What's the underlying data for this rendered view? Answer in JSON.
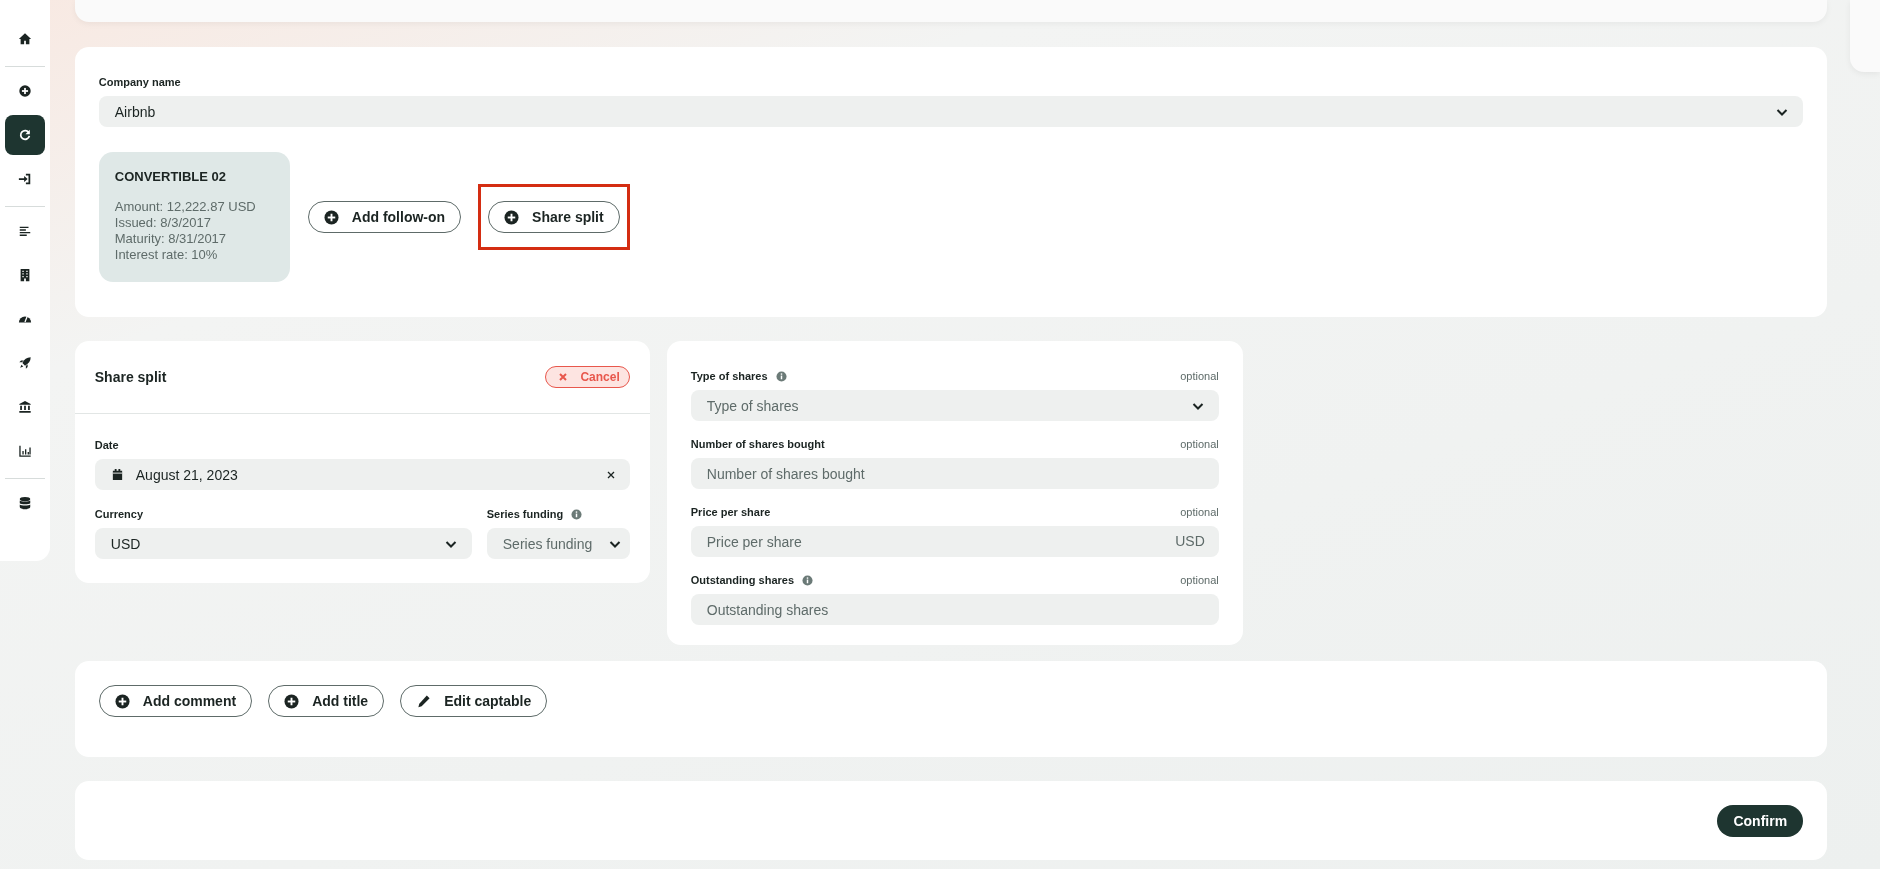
{
  "sidebar": {
    "groups": [
      {
        "items": [
          {
            "selected": false
          }
        ]
      },
      {
        "items": [
          {
            "selected": false
          },
          {
            "selected": true
          },
          {
            "selected": false
          }
        ]
      },
      {
        "items": [
          {
            "selected": false
          },
          {
            "selected": false
          },
          {
            "selected": false
          },
          {
            "selected": false
          },
          {
            "selected": false
          },
          {
            "selected": false
          }
        ]
      },
      {
        "items": [
          {
            "selected": false
          }
        ]
      }
    ]
  },
  "company": {
    "label": "Company name",
    "value": "Airbnb",
    "instrument": {
      "title": "CONVERTIBLE 02",
      "lines": [
        "Amount: 12,222.87 USD",
        "Issued: 8/3/2017",
        "Maturity: 8/31/2017",
        "Interest rate: 10%"
      ]
    },
    "actions": [
      {
        "label": "Add follow-on",
        "highlighted": false
      },
      {
        "label": "Share split",
        "highlighted": true
      }
    ]
  },
  "share_split": {
    "title": "Share split",
    "cancel": "Cancel",
    "fields": [
      {
        "kind": "date",
        "label": "Date",
        "info": false,
        "value": "August 21, 2023"
      },
      {
        "kind": "select",
        "label": "Currency",
        "info": false,
        "value": "USD"
      },
      {
        "kind": "select",
        "label": "Series funding",
        "info": true,
        "placeholder": "Series funding"
      }
    ]
  },
  "details": {
    "fields": [
      {
        "kind": "select",
        "label": "Type of shares",
        "info": true,
        "note": "optional",
        "placeholder": "Type of shares"
      },
      {
        "kind": "input",
        "label": "Number of shares bought",
        "info": false,
        "note": "optional",
        "placeholder": "Number of shares bought"
      },
      {
        "kind": "input",
        "label": "Price per share",
        "info": false,
        "note": "optional",
        "placeholder": "Price per share",
        "suffix": "USD"
      },
      {
        "kind": "input",
        "label": "Outstanding shares",
        "info": true,
        "note": "optional",
        "placeholder": "Outstanding shares"
      }
    ]
  },
  "extras": [
    {
      "kind": "add",
      "label": "Add comment"
    },
    {
      "kind": "add",
      "label": "Add title"
    },
    {
      "kind": "edit",
      "label": "Edit captable"
    }
  ],
  "confirm": "Confirm"
}
